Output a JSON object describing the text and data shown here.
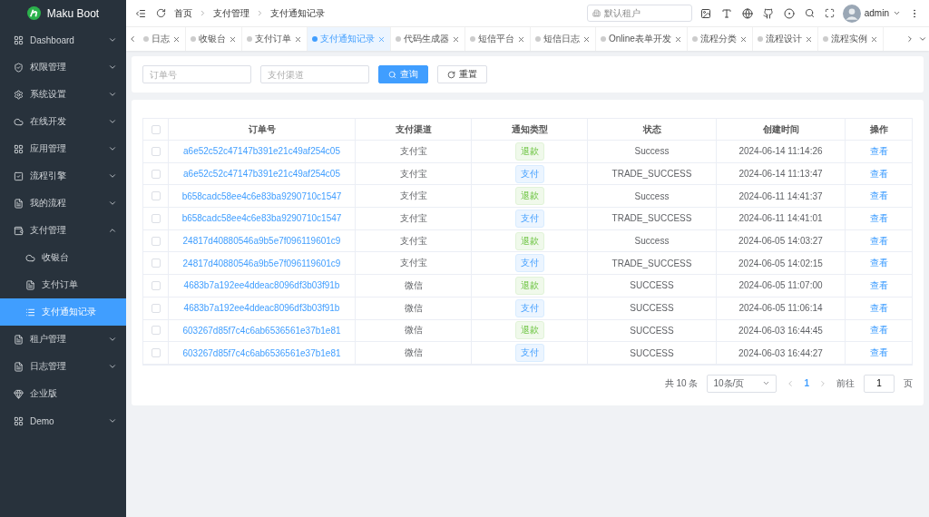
{
  "brand": {
    "name": "Maku Boot"
  },
  "sidebar": {
    "items": [
      {
        "label": "Dashboard",
        "kind": "group",
        "expanded": false
      },
      {
        "label": "权限管理",
        "kind": "group",
        "expanded": false
      },
      {
        "label": "系统设置",
        "kind": "group",
        "expanded": false
      },
      {
        "label": "在线开发",
        "kind": "group",
        "expanded": false
      },
      {
        "label": "应用管理",
        "kind": "group",
        "expanded": false
      },
      {
        "label": "流程引擎",
        "kind": "group",
        "expanded": false
      },
      {
        "label": "我的流程",
        "kind": "group",
        "expanded": false
      },
      {
        "label": "支付管理",
        "kind": "group",
        "expanded": true,
        "children": [
          {
            "label": "收银台",
            "selected": false
          },
          {
            "label": "支付订单",
            "selected": false
          },
          {
            "label": "支付通知记录",
            "selected": true
          }
        ]
      },
      {
        "label": "租户管理",
        "kind": "group",
        "expanded": false
      },
      {
        "label": "日志管理",
        "kind": "group",
        "expanded": false
      },
      {
        "label": "企业版",
        "kind": "link"
      },
      {
        "label": "Demo",
        "kind": "group",
        "expanded": false
      }
    ]
  },
  "breadcrumb": [
    "首页",
    "支付管理",
    "支付通知记录"
  ],
  "tenant_select": {
    "placeholder": "默认租户"
  },
  "user": {
    "name": "admin"
  },
  "tabs": [
    {
      "label": "日志",
      "selected": false
    },
    {
      "label": "收银台",
      "selected": false
    },
    {
      "label": "支付订单",
      "selected": false
    },
    {
      "label": "支付通知记录",
      "selected": true
    },
    {
      "label": "代码生成器",
      "selected": false
    },
    {
      "label": "短信平台",
      "selected": false
    },
    {
      "label": "短信日志",
      "selected": false
    },
    {
      "label": "Online表单开发",
      "selected": false
    },
    {
      "label": "流程分类",
      "selected": false
    },
    {
      "label": "流程设计",
      "selected": false
    },
    {
      "label": "流程实例",
      "selected": false
    }
  ],
  "filters": [
    {
      "placeholder": "订单号"
    },
    {
      "placeholder": "支付渠道"
    }
  ],
  "buttons": {
    "query": "查询",
    "reset": "重置"
  },
  "table": {
    "select_all": false,
    "columns": [
      "订单号",
      "支付渠道",
      "通知类型",
      "状态",
      "创建时间",
      "操作"
    ],
    "rows": [
      {
        "order": "a6e52c52c47147b391e21c49af254c05",
        "channel": "支付宝",
        "type": {
          "label": "退款",
          "kind": "refund"
        },
        "status": "Success",
        "time": "2024-06-14 11:14:26",
        "action": "查看",
        "checked": false
      },
      {
        "order": "a6e52c52c47147b391e21c49af254c05",
        "channel": "支付宝",
        "type": {
          "label": "支付",
          "kind": "pay"
        },
        "status": "TRADE_SUCCESS",
        "time": "2024-06-14 11:13:47",
        "action": "查看",
        "checked": false
      },
      {
        "order": "b658cadc58ee4c6e83ba9290710c1547",
        "channel": "支付宝",
        "type": {
          "label": "退款",
          "kind": "refund"
        },
        "status": "Success",
        "time": "2024-06-11 14:41:37",
        "action": "查看",
        "checked": false
      },
      {
        "order": "b658cadc58ee4c6e83ba9290710c1547",
        "channel": "支付宝",
        "type": {
          "label": "支付",
          "kind": "pay"
        },
        "status": "TRADE_SUCCESS",
        "time": "2024-06-11 14:41:01",
        "action": "查看",
        "checked": false
      },
      {
        "order": "24817d40880546a9b5e7f096119601c9",
        "channel": "支付宝",
        "type": {
          "label": "退款",
          "kind": "refund"
        },
        "status": "Success",
        "time": "2024-06-05 14:03:27",
        "action": "查看",
        "checked": false
      },
      {
        "order": "24817d40880546a9b5e7f096119601c9",
        "channel": "支付宝",
        "type": {
          "label": "支付",
          "kind": "pay"
        },
        "status": "TRADE_SUCCESS",
        "time": "2024-06-05 14:02:15",
        "action": "查看",
        "checked": false
      },
      {
        "order": "4683b7a192ee4ddeac8096df3b03f91b",
        "channel": "微信",
        "type": {
          "label": "退款",
          "kind": "refund"
        },
        "status": "SUCCESS",
        "time": "2024-06-05 11:07:00",
        "action": "查看",
        "checked": false
      },
      {
        "order": "4683b7a192ee4ddeac8096df3b03f91b",
        "channel": "微信",
        "type": {
          "label": "支付",
          "kind": "pay"
        },
        "status": "SUCCESS",
        "time": "2024-06-05 11:06:14",
        "action": "查看",
        "checked": false
      },
      {
        "order": "603267d85f7c4c6ab6536561e37b1e81",
        "channel": "微信",
        "type": {
          "label": "退款",
          "kind": "refund"
        },
        "status": "SUCCESS",
        "time": "2024-06-03 16:44:45",
        "action": "查看",
        "checked": false
      },
      {
        "order": "603267d85f7c4c6ab6536561e37b1e81",
        "channel": "微信",
        "type": {
          "label": "支付",
          "kind": "pay"
        },
        "status": "SUCCESS",
        "time": "2024-06-03 16:44:27",
        "action": "查看",
        "checked": false
      }
    ]
  },
  "pagination": {
    "total": "共 10 条",
    "page_size": "10条/页",
    "pages": [
      {
        "label": "1",
        "selected": true
      }
    ],
    "goto_label": "前往",
    "goto_value": "1",
    "page_suffix": "页"
  }
}
